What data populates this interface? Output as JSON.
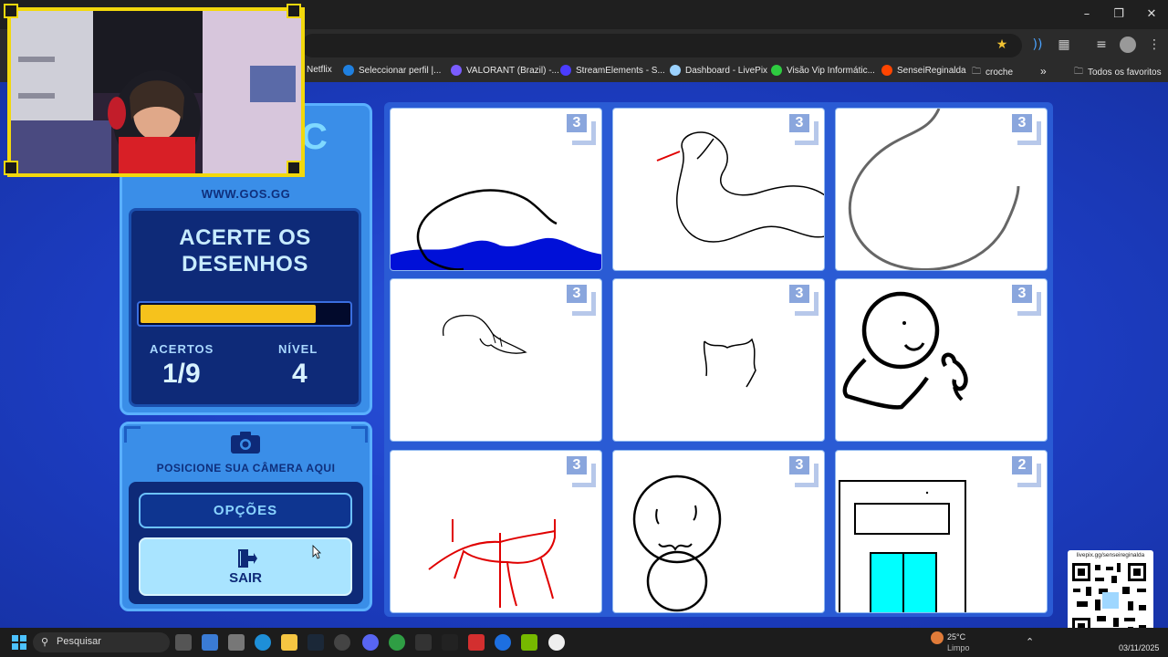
{
  "browser": {
    "bookmarks": [
      {
        "label": "Netflix",
        "color": "#e50914"
      },
      {
        "label": "Seleccionar perfil |...",
        "color": "#1f80e0"
      },
      {
        "label": "VALORANT (Brazil) -...",
        "color": "#7a5cff"
      },
      {
        "label": "StreamElements - S...",
        "color": "#4b3cff"
      },
      {
        "label": "Dashboard - LivePix",
        "color": "#9bd2ff"
      },
      {
        "label": "Visão Vip Informátic...",
        "color": "#2ecc40"
      },
      {
        "label": "SenseiReginalda",
        "color": "#ff4500"
      },
      {
        "label": "croche",
        "color": "#bbbbbb"
      }
    ],
    "all_bookmarks_label": "Todos os favoritos"
  },
  "game": {
    "logo_text": "C",
    "site_url": "WWW.GOS.GG",
    "headline_line1": "ACERTE OS",
    "headline_line2": "DESENHOS",
    "progress_fraction": 0.84,
    "hits_label": "ACERTOS",
    "hits_value": "1/9",
    "level_label": "NÍVEL",
    "level_value": "4",
    "camera_prompt": "POSICIONE SUA CÂMERA AQUI",
    "options_label": "OPÇÕES",
    "exit_label": "SAIR",
    "tiles": [
      {
        "count": "3",
        "drawing": "whale"
      },
      {
        "count": "3",
        "drawing": "snake"
      },
      {
        "count": "3",
        "drawing": "curve"
      },
      {
        "count": "3",
        "drawing": "rat"
      },
      {
        "count": "3",
        "drawing": "cup"
      },
      {
        "count": "3",
        "drawing": "person-mic"
      },
      {
        "count": "3",
        "drawing": "table"
      },
      {
        "count": "3",
        "drawing": "snowman"
      },
      {
        "count": "2",
        "drawing": "building"
      }
    ]
  },
  "overlay": {
    "qr_url": "livepix.gg/senseireginalda"
  },
  "taskbar": {
    "search_placeholder": "Pesquisar",
    "weather_temp": "25°C",
    "weather_desc": "Limpo",
    "date": "03/11/2025"
  },
  "colors": {
    "accent_yellow": "#f6c21c",
    "game_blue": "#1d3ec9",
    "panel_light": "#3a8ee8",
    "panel_dark": "#0e2a78"
  }
}
